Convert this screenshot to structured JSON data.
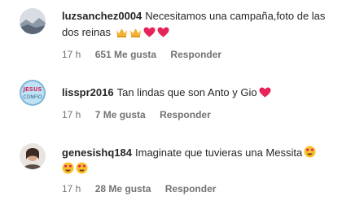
{
  "comments": [
    {
      "username": "luzsanchez0004",
      "text": "Necesitamos una campaña,foto de las dos reinas",
      "emojis": [
        "crown-emoji",
        "crown-emoji",
        "heart-emoji",
        "heart-emoji"
      ],
      "time": "17 h",
      "likes": "651 Me gusta",
      "reply": "Responder"
    },
    {
      "username": "lisspr2016",
      "text": "Tan lindas que son Anto y Gio",
      "emojis": [
        "heart-emoji"
      ],
      "time": "17 h",
      "likes": "7 Me gusta",
      "reply": "Responder"
    },
    {
      "username": "genesishq184",
      "text": "Imaginate que tuvieras una Messita",
      "emojis": [
        "heart-eyes-emoji",
        "heart-eyes-emoji",
        "heart-eyes-emoji"
      ],
      "time": "17 h",
      "likes": "28 Me gusta",
      "reply": "Responder"
    }
  ],
  "colors": {
    "meta": "#737373",
    "text": "#262626",
    "heart": "#e5245a"
  }
}
